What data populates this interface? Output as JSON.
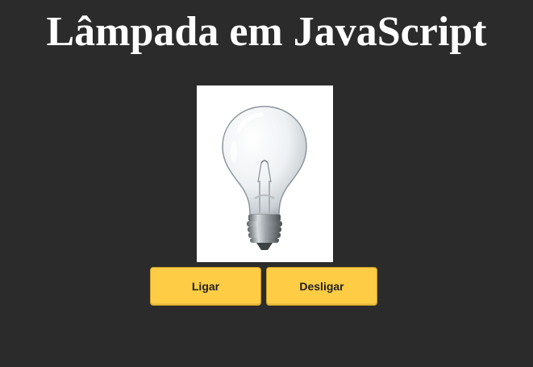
{
  "page": {
    "title": "Lâmpada em JavaScript"
  },
  "lamp": {
    "state": "off",
    "icon": "lightbulb-icon"
  },
  "controls": {
    "on_label": "Ligar",
    "off_label": "Desligar"
  },
  "colors": {
    "background": "#2b2b2b",
    "title": "#ffffff",
    "button": "#ffcd45",
    "button_text": "#222222"
  }
}
